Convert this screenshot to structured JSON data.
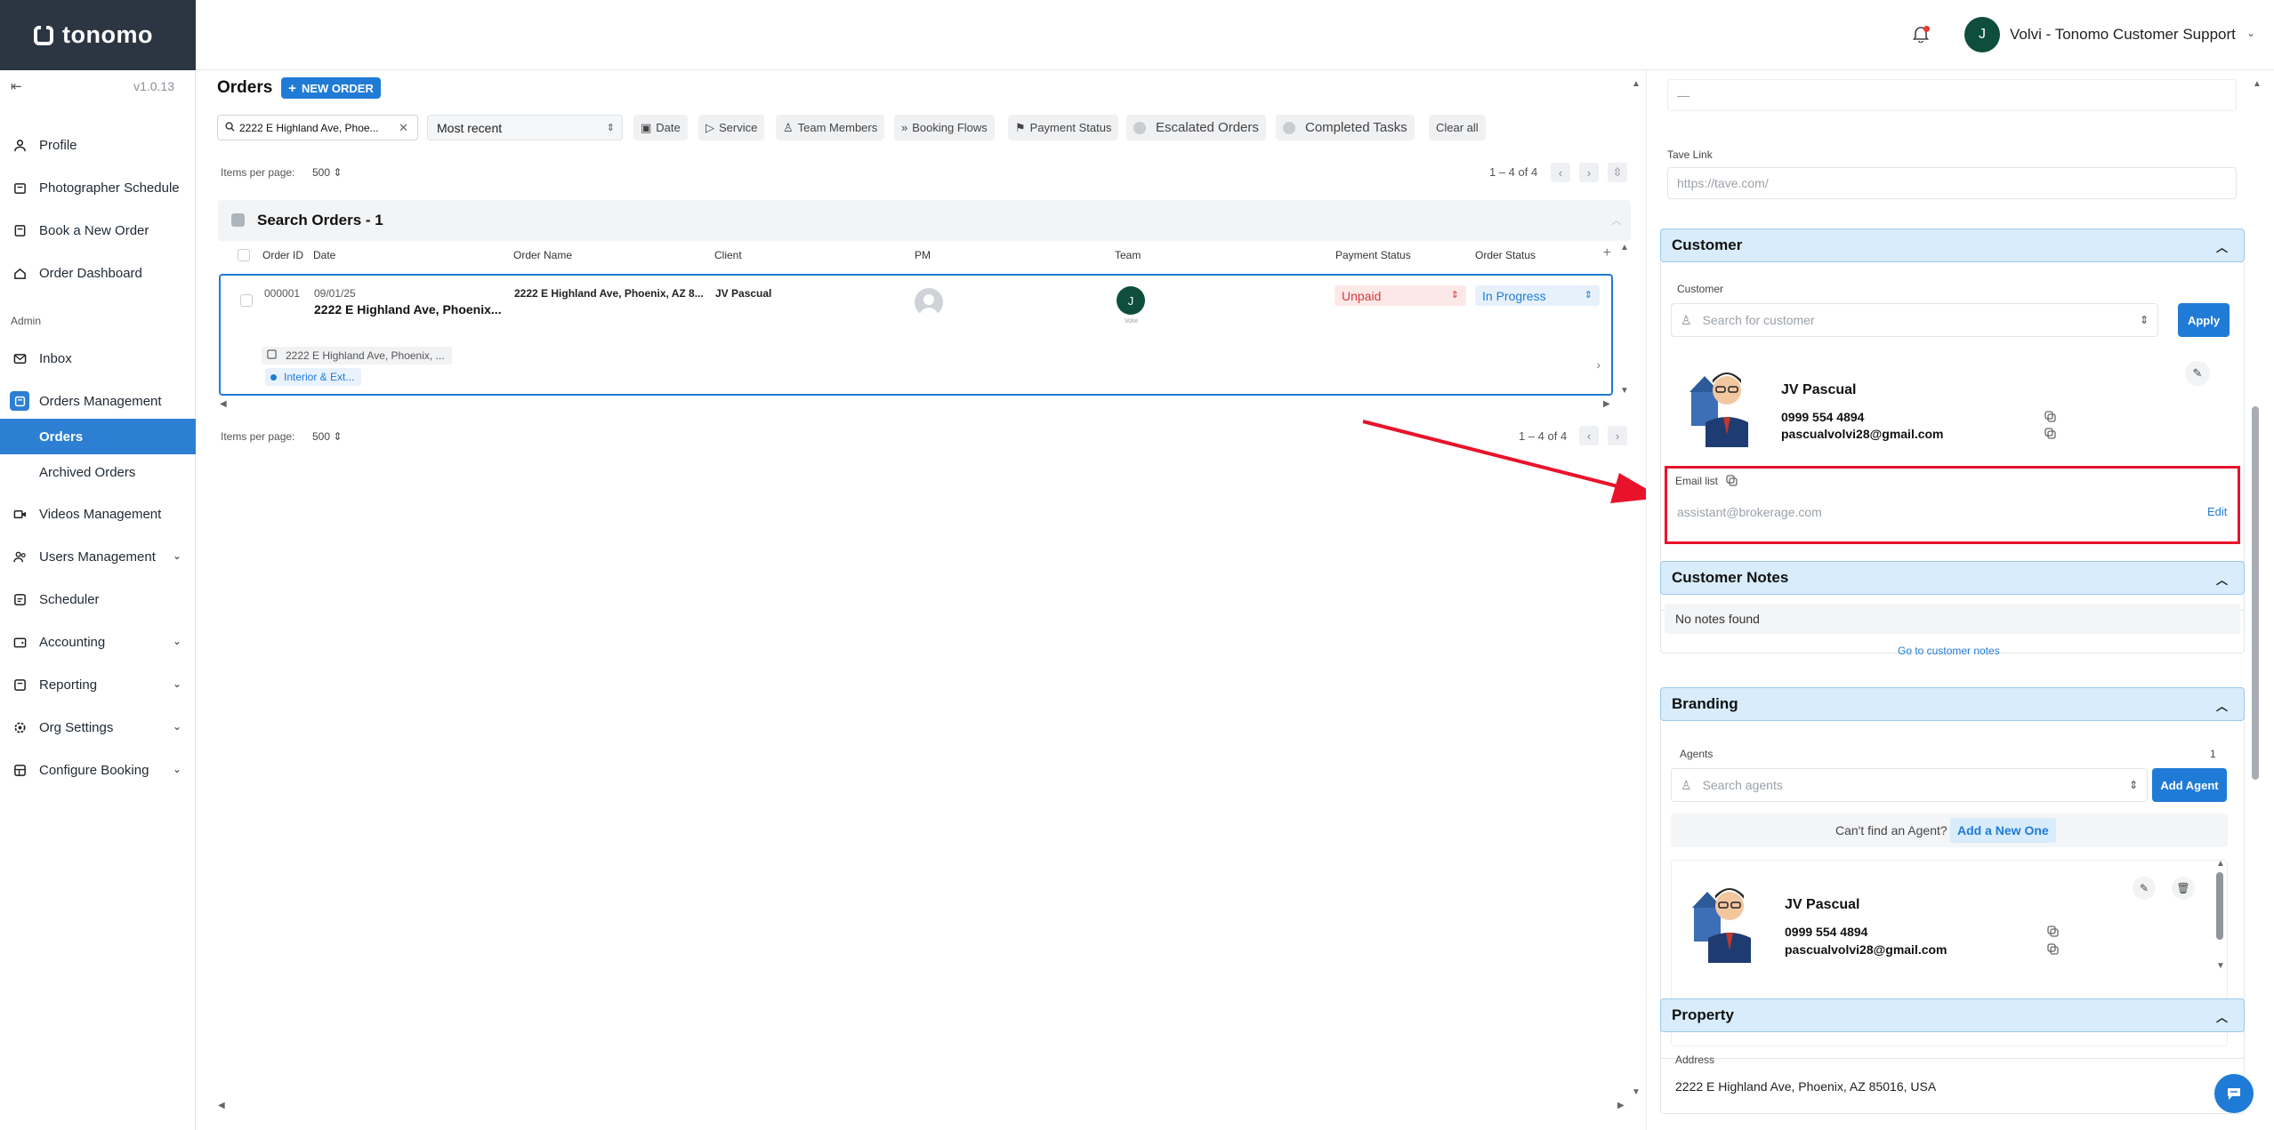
{
  "app": {
    "logo_text": "tonomo",
    "version": "v1.0.13"
  },
  "user": {
    "initial": "J",
    "name": "Volvi - Tonomo Customer Support"
  },
  "sidebar": {
    "items": [
      {
        "label": "Profile",
        "icon": "person-icon"
      },
      {
        "label": "Photographer Schedule",
        "icon": "calendar-icon"
      },
      {
        "label": "Book a New Order",
        "icon": "book-icon"
      },
      {
        "label": "Order Dashboard",
        "icon": "home-icon"
      }
    ],
    "admin_label": "Admin",
    "admin_items": [
      {
        "label": "Inbox",
        "icon": "mail-icon"
      },
      {
        "label": "Orders Management",
        "icon": "orders-icon"
      },
      {
        "label": "Orders",
        "icon": ""
      },
      {
        "label": "Archived Orders",
        "icon": ""
      },
      {
        "label": "Videos Management",
        "icon": "video-icon"
      },
      {
        "label": "Users Management",
        "icon": "users-icon"
      },
      {
        "label": "Scheduler",
        "icon": "scheduler-icon"
      },
      {
        "label": "Accounting",
        "icon": "wallet-icon"
      },
      {
        "label": "Reporting",
        "icon": "report-icon"
      },
      {
        "label": "Org Settings",
        "icon": "gear-icon"
      },
      {
        "label": "Configure Booking",
        "icon": "booking-icon"
      }
    ]
  },
  "orders": {
    "title": "Orders",
    "new_order_label": "NEW ORDER",
    "search_value": "2222 E Highland Ave, Phoe...",
    "sort_value": "Most recent",
    "filters": [
      "Date",
      "Service",
      "Team Members",
      "Booking Flows",
      "Payment Status"
    ],
    "toggles": [
      "Escalated Orders",
      "Completed Tasks"
    ],
    "clear_all": "Clear all",
    "items_per_page_label": "Items per page:",
    "items_per_page_value": "500",
    "range_text": "1 – 4 of 4",
    "group_title": "Search Orders - 1",
    "columns": [
      "Order ID",
      "Date",
      "Order Name",
      "Client",
      "PM",
      "Team",
      "Payment Status",
      "Order Status"
    ],
    "row": {
      "order_id": "000001",
      "date": "09/01/25",
      "title": "2222 E Highland Ave, Phoenix...",
      "order_name": "2222 E Highland Ave, Phoenix, AZ 8...",
      "client": "JV Pascual",
      "team_initial": "J",
      "team_name": "Volvi",
      "payment_status": "Unpaid",
      "order_status": "In Progress",
      "address_chip": "2222 E Highland Ave, Phoenix, ...",
      "service_chip": "Interior & Ext..."
    }
  },
  "panel": {
    "top_dash": "—",
    "tave_label": "Tave Link",
    "tave_placeholder": "https://tave.com/",
    "customer": {
      "section_title": "Customer",
      "field_label": "Customer",
      "search_placeholder": "Search for customer",
      "apply_label": "Apply",
      "name": "JV Pascual",
      "phone": "0999 554 4894",
      "email": "pascualvolvi28@gmail.com",
      "email_list_label": "Email list",
      "email_list_placeholder": "assistant@brokerage.com",
      "edit_label": "Edit"
    },
    "notes": {
      "section_title": "Customer Notes",
      "empty_text": "No notes found",
      "link_label": "Go to customer notes"
    },
    "branding": {
      "section_title": "Branding",
      "agents_label": "Agents",
      "agents_count": "1",
      "search_placeholder": "Search agents",
      "add_agent_label": "Add Agent",
      "cant_find_text": "Can't find an Agent?",
      "add_new_label": "Add a New One",
      "agent_name": "JV Pascual",
      "agent_phone": "0999 554 4894",
      "agent_email": "pascualvolvi28@gmail.com"
    },
    "property": {
      "section_title": "Property",
      "address_label": "Address",
      "address_value": "2222 E Highland Ave, Phoenix, AZ 85016, USA"
    }
  },
  "colors": {
    "accent": "#1f7bd6",
    "sidebar_header": "#2c3542",
    "highlight": "#e8132b"
  }
}
